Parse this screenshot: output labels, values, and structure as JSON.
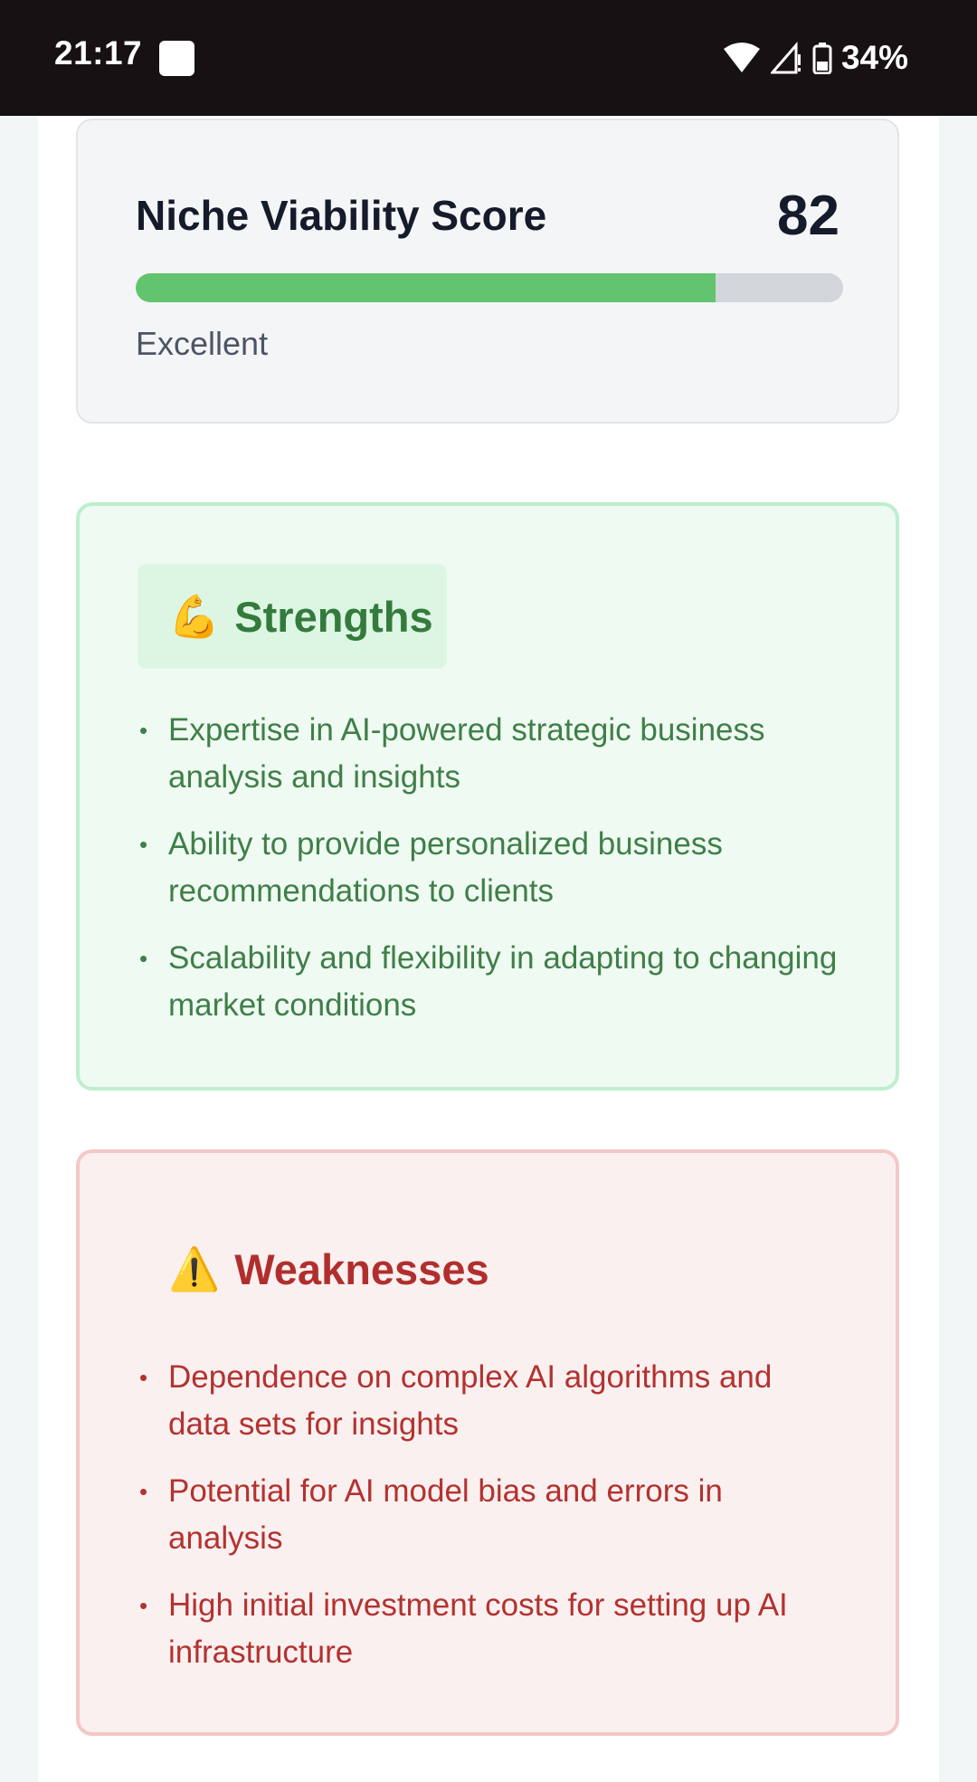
{
  "status_bar": {
    "time": "21:17",
    "battery": "34%"
  },
  "score": {
    "title": "Niche Viability Score",
    "value": "82",
    "progress_percent": 82,
    "rating": "Excellent",
    "fill_color": "#62c46e"
  },
  "strengths": {
    "emoji": "💪",
    "title": "Strengths",
    "items": [
      "Expertise in AI-powered strategic business analysis and insights",
      "Ability to provide personalized business recommendations to clients",
      "Scalability and flexibility in adapting to changing market conditions"
    ]
  },
  "weaknesses": {
    "emoji": "⚠️",
    "title": "Weaknesses",
    "items": [
      "Dependence on complex AI algorithms and data sets for insights",
      "Potential for AI model bias and errors in analysis",
      "High initial investment costs for setting up AI infrastructure"
    ]
  }
}
